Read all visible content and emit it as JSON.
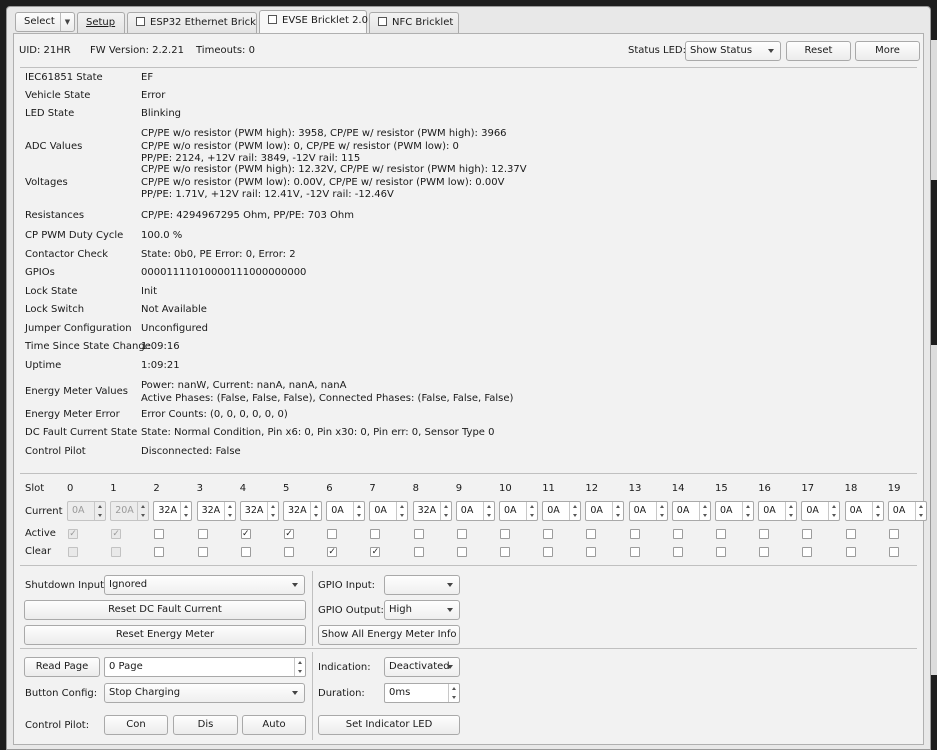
{
  "tabbar": {
    "select_label": "Select",
    "tabs": [
      {
        "label": "Setup"
      },
      {
        "label": "ESP32 Ethernet Brick"
      },
      {
        "label": "EVSE Bricklet 2.0"
      },
      {
        "label": "NFC Bricklet"
      }
    ]
  },
  "header": {
    "uid": "UID:  21HR",
    "fw": "FW Version:  2.2.21",
    "timeouts": "Timeouts:  0",
    "status_led_label": "Status LED:",
    "status_led_value": "Show Status",
    "reset_label": "Reset",
    "more_label": "More"
  },
  "properties": [
    {
      "label": "IEC61851 State",
      "lines": [
        "EF"
      ]
    },
    {
      "label": "Vehicle State",
      "lines": [
        "Error"
      ]
    },
    {
      "label": "LED State",
      "lines": [
        "Blinking"
      ]
    },
    {
      "label": "ADC Values",
      "lines": [
        "CP/PE w/o resistor (PWM high): 3958, CP/PE w/ resistor (PWM high): 3966",
        "CP/PE w/o resistor (PWM low): 0, CP/PE w/ resistor (PWM low): 0",
        "PP/PE: 2124, +12V rail: 3849, -12V rail: 115"
      ]
    },
    {
      "label": "Voltages",
      "lines": [
        "CP/PE w/o resistor (PWM high): 12.32V, CP/PE w/ resistor (PWM high): 12.37V",
        "CP/PE w/o resistor (PWM low): 0.00V, CP/PE w/ resistor (PWM low): 0.00V",
        "PP/PE: 1.71V, +12V rail: 12.41V, -12V rail: -12.46V"
      ]
    },
    {
      "label": "Resistances",
      "lines": [
        "CP/PE: 4294967295 Ohm, PP/PE: 703 Ohm"
      ]
    },
    {
      "label": "CP PWM Duty Cycle",
      "lines": [
        "100.0 %"
      ]
    },
    {
      "label": "Contactor Check",
      "lines": [
        "State: 0b0, PE Error: 0, Error: 2"
      ]
    },
    {
      "label": "GPIOs",
      "lines": [
        "00001111010000111000000000"
      ]
    },
    {
      "label": "Lock State",
      "lines": [
        "Init"
      ]
    },
    {
      "label": "Lock Switch",
      "lines": [
        "Not Available"
      ]
    },
    {
      "label": "Jumper Configuration",
      "lines": [
        "Unconfigured"
      ]
    },
    {
      "label": "Time Since State Change",
      "lines": [
        "1:09:16"
      ]
    },
    {
      "label": "Uptime",
      "lines": [
        "1:09:21"
      ]
    },
    {
      "label": "Energy Meter Values",
      "lines": [
        "Power: nanW, Current: nanA, nanA, nanA",
        "Active Phases: (False, False, False), Connected Phases: (False, False, False)"
      ]
    },
    {
      "label": "Energy Meter Error",
      "lines": [
        "Error Counts: (0, 0, 0, 0, 0, 0)"
      ]
    },
    {
      "label": "DC Fault Current State",
      "lines": [
        "State: Normal Condition, Pin x6: 0, Pin x30: 0, Pin err: 0, Sensor Type 0"
      ]
    },
    {
      "label": "Control Pilot",
      "lines": [
        "Disconnected: False"
      ]
    }
  ],
  "slots": {
    "slot_label": "Slot",
    "current_label": "Current",
    "active_label": "Active",
    "clear_label": "Clear",
    "numbers": [
      "0",
      "1",
      "2",
      "3",
      "4",
      "5",
      "6",
      "7",
      "8",
      "9",
      "10",
      "11",
      "12",
      "13",
      "14",
      "15",
      "16",
      "17",
      "18",
      "19"
    ],
    "currents": [
      "0A",
      "20A",
      "32A",
      "32A",
      "32A",
      "32A",
      "0A",
      "0A",
      "32A",
      "0A",
      "0A",
      "0A",
      "0A",
      "0A",
      "0A",
      "0A",
      "0A",
      "0A",
      "0A",
      "0A"
    ],
    "disabled": [
      true,
      true,
      false,
      false,
      false,
      false,
      false,
      false,
      false,
      false,
      false,
      false,
      false,
      false,
      false,
      false,
      false,
      false,
      false,
      false
    ],
    "active": [
      true,
      true,
      false,
      false,
      true,
      true,
      false,
      false,
      false,
      false,
      false,
      false,
      false,
      false,
      false,
      false,
      false,
      false,
      false,
      false
    ],
    "clear": [
      false,
      false,
      false,
      false,
      false,
      false,
      true,
      true,
      false,
      false,
      false,
      false,
      false,
      false,
      false,
      false,
      false,
      false,
      false,
      false
    ]
  },
  "controls": {
    "shutdown_input_label": "Shutdown Input:",
    "shutdown_input_value": "Ignored",
    "reset_dc_label": "Reset DC Fault Current",
    "reset_energy_label": "Reset Energy Meter",
    "gpio_input_label": "GPIO Input:",
    "gpio_input_value": "",
    "gpio_output_label": "GPIO Output:",
    "gpio_output_value": "High",
    "show_all_label": "Show All Energy Meter Info",
    "read_page_label": "Read Page",
    "page_value": "0 Page",
    "button_config_label": "Button Config:",
    "button_config_value": "Stop Charging",
    "control_pilot_label": "Control Pilot:",
    "con_label": "Con",
    "dis_label": "Dis",
    "auto_label": "Auto",
    "indication_label": "Indication:",
    "indication_value": "Deactivated",
    "duration_label": "Duration:",
    "duration_value": "0ms",
    "set_led_label": "Set Indicator LED"
  }
}
